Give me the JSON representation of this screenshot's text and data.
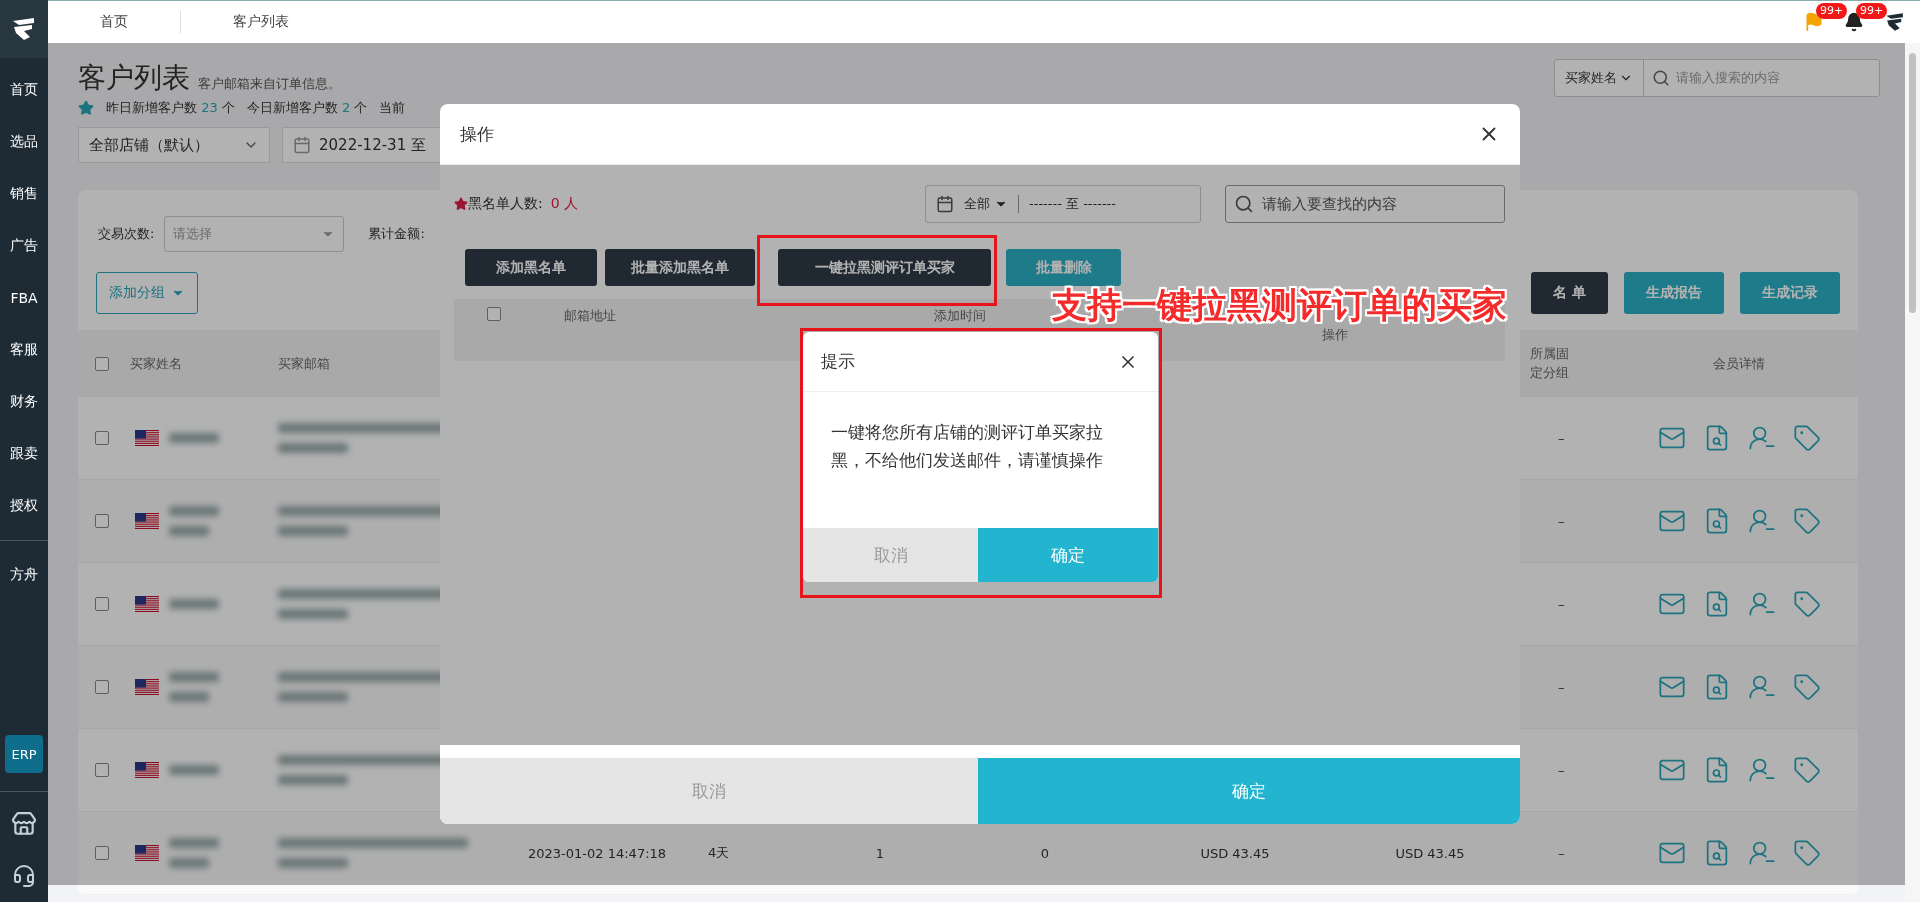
{
  "topbar": {
    "breadcrumbs": [
      "首页",
      "客户列表"
    ],
    "flag_badge": "99+",
    "bell_badge": "99+"
  },
  "sidebar": {
    "items": [
      "首页",
      "选品",
      "销售",
      "广告",
      "FBA",
      "客服",
      "财务",
      "跟卖",
      "授权"
    ],
    "items_2": [
      "方舟"
    ],
    "erp": "ERP"
  },
  "page": {
    "title": "客户列表",
    "subtitle": "客户邮箱来自订单信息。",
    "stats": [
      {
        "label": "昨日新增客户数",
        "value": "23",
        "unit": "个"
      },
      {
        "label": "今日新增客户数",
        "value": "2",
        "unit": "个"
      },
      {
        "label": "当前"
      }
    ],
    "store_select": "全部店铺（默认）",
    "date_from": "2022-12-31 至",
    "search_field": "买家姓名",
    "search_placeholder": "请输入搜索的内容"
  },
  "card": {
    "filters": [
      {
        "label": "交易次数:",
        "placeholder": "请选择"
      },
      {
        "label": "累计金额:"
      }
    ],
    "add_group": "添加分组",
    "buttons": [
      {
        "label": "名 单",
        "kind": "dark"
      },
      {
        "label": "生成报告",
        "kind": "teal"
      },
      {
        "label": "生成记录",
        "kind": "teal"
      }
    ],
    "header_checked": false,
    "columns": {
      "name": "买家姓名",
      "email": "买家邮箱",
      "group": "所属固定分组",
      "member": "会员详情"
    },
    "rows": [
      {
        "checked": false,
        "group": "–"
      },
      {
        "checked": false,
        "group": "–"
      },
      {
        "checked": false,
        "group": "–"
      },
      {
        "checked": false,
        "group": "–"
      },
      {
        "checked": false,
        "group": "–"
      },
      {
        "checked": false,
        "column_4": "2023-01-02 14:47:18",
        "column_5": "4天",
        "column_6": "1",
        "column_7": "0",
        "column_8": "USD 43.45",
        "column_9": "USD 43.45",
        "group": "–"
      }
    ]
  },
  "modal": {
    "title": "操作",
    "count_label": "黑名单人数:",
    "count_value": "0 人",
    "date_range": "全部",
    "date_from": "-------",
    "date_sep": "至",
    "date_to": "-------",
    "search_placeholder": "请输入要查找的内容",
    "buttons": [
      {
        "label": "添加黑名单",
        "kind": "dark"
      },
      {
        "label": "批量添加黑名单",
        "kind": "dark"
      },
      {
        "label": "一键拉黑测评订单买家",
        "kind": "dark"
      },
      {
        "label": "批量删除",
        "kind": "teal"
      }
    ],
    "header_checked": false,
    "columns": [
      "邮箱地址",
      "添加时间",
      "操作"
    ],
    "cancel": "取消",
    "ok": "确定"
  },
  "dialog": {
    "title": "提示",
    "message": "一键将您所有店铺的测评订单买家拉黑，不给他们发送邮件，请谨慎操作",
    "cancel": "取消",
    "ok": "确定"
  },
  "annotation": {
    "text": "支持一键拉黑测评订单的买家"
  }
}
